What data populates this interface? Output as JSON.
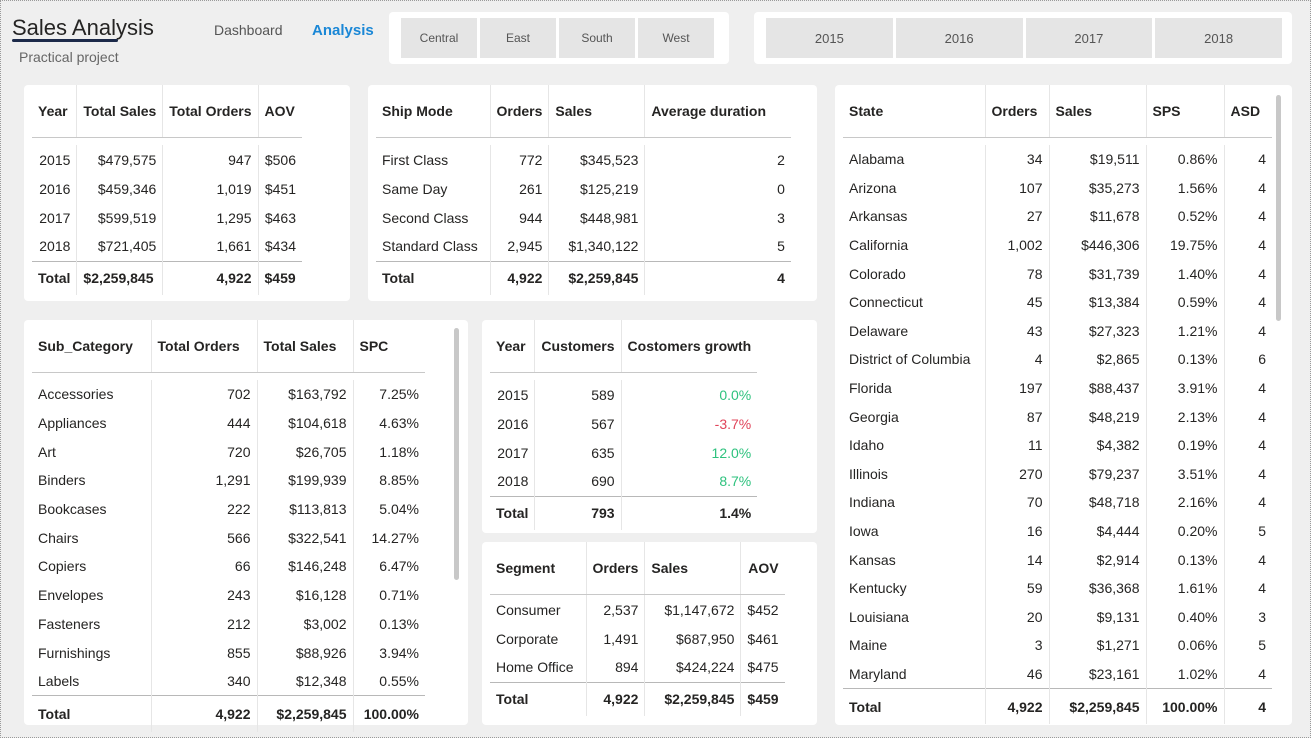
{
  "header": {
    "title": "Sales Analysis",
    "subtitle": "Practical project",
    "nav": [
      {
        "label": "Dashboard",
        "active": false
      },
      {
        "label": "Analysis",
        "active": true
      }
    ]
  },
  "region_slicer": [
    "Central",
    "East",
    "South",
    "West"
  ],
  "year_slicer": [
    "2015",
    "2016",
    "2017",
    "2018"
  ],
  "colors": {
    "accent": "#1a87d6",
    "positive": "#2ec27e",
    "negative": "#e0445a"
  },
  "year_table": {
    "headers": [
      "Year",
      "Total Sales",
      "Total Orders",
      "AOV"
    ],
    "rows": [
      [
        "2015",
        "$479,575",
        "947",
        "$506"
      ],
      [
        "2016",
        "$459,346",
        "1,019",
        "$451"
      ],
      [
        "2017",
        "$599,519",
        "1,295",
        "$463"
      ],
      [
        "2018",
        "$721,405",
        "1,661",
        "$434"
      ]
    ],
    "total": [
      "Total",
      "$2,259,845",
      "4,922",
      "$459"
    ]
  },
  "ship_table": {
    "headers": [
      "Ship Mode",
      "Orders",
      "Sales",
      "Average duration"
    ],
    "rows": [
      [
        "First Class",
        "772",
        "$345,523",
        "2"
      ],
      [
        "Same Day",
        "261",
        "$125,219",
        "0"
      ],
      [
        "Second Class",
        "944",
        "$448,981",
        "3"
      ],
      [
        "Standard Class",
        "2,945",
        "$1,340,122",
        "5"
      ]
    ],
    "total": [
      "Total",
      "4,922",
      "$2,259,845",
      "4"
    ]
  },
  "state_table": {
    "headers": [
      "State",
      "Orders",
      "Sales",
      "SPS",
      "ASD"
    ],
    "rows": [
      [
        "Alabama",
        "34",
        "$19,511",
        "0.86%",
        "4"
      ],
      [
        "Arizona",
        "107",
        "$35,273",
        "1.56%",
        "4"
      ],
      [
        "Arkansas",
        "27",
        "$11,678",
        "0.52%",
        "4"
      ],
      [
        "California",
        "1,002",
        "$446,306",
        "19.75%",
        "4"
      ],
      [
        "Colorado",
        "78",
        "$31,739",
        "1.40%",
        "4"
      ],
      [
        "Connecticut",
        "45",
        "$13,384",
        "0.59%",
        "4"
      ],
      [
        "Delaware",
        "43",
        "$27,323",
        "1.21%",
        "4"
      ],
      [
        "District of Columbia",
        "4",
        "$2,865",
        "0.13%",
        "6"
      ],
      [
        "Florida",
        "197",
        "$88,437",
        "3.91%",
        "4"
      ],
      [
        "Georgia",
        "87",
        "$48,219",
        "2.13%",
        "4"
      ],
      [
        "Idaho",
        "11",
        "$4,382",
        "0.19%",
        "4"
      ],
      [
        "Illinois",
        "270",
        "$79,237",
        "3.51%",
        "4"
      ],
      [
        "Indiana",
        "70",
        "$48,718",
        "2.16%",
        "4"
      ],
      [
        "Iowa",
        "16",
        "$4,444",
        "0.20%",
        "5"
      ],
      [
        "Kansas",
        "14",
        "$2,914",
        "0.13%",
        "4"
      ],
      [
        "Kentucky",
        "59",
        "$36,368",
        "1.61%",
        "4"
      ],
      [
        "Louisiana",
        "20",
        "$9,131",
        "0.40%",
        "3"
      ],
      [
        "Maine",
        "3",
        "$1,271",
        "0.06%",
        "5"
      ],
      [
        "Maryland",
        "46",
        "$23,161",
        "1.02%",
        "4"
      ]
    ],
    "total": [
      "Total",
      "4,922",
      "$2,259,845",
      "100.00%",
      "4"
    ]
  },
  "subcat_table": {
    "headers": [
      "Sub_Category",
      "Total Orders",
      "Total Sales",
      "SPC"
    ],
    "rows": [
      [
        "Accessories",
        "702",
        "$163,792",
        "7.25%"
      ],
      [
        "Appliances",
        "444",
        "$104,618",
        "4.63%"
      ],
      [
        "Art",
        "720",
        "$26,705",
        "1.18%"
      ],
      [
        "Binders",
        "1,291",
        "$199,939",
        "8.85%"
      ],
      [
        "Bookcases",
        "222",
        "$113,813",
        "5.04%"
      ],
      [
        "Chairs",
        "566",
        "$322,541",
        "14.27%"
      ],
      [
        "Copiers",
        "66",
        "$146,248",
        "6.47%"
      ],
      [
        "Envelopes",
        "243",
        "$16,128",
        "0.71%"
      ],
      [
        "Fasteners",
        "212",
        "$3,002",
        "0.13%"
      ],
      [
        "Furnishings",
        "855",
        "$88,926",
        "3.94%"
      ],
      [
        "Labels",
        "340",
        "$12,348",
        "0.55%"
      ]
    ],
    "total": [
      "Total",
      "4,922",
      "$2,259,845",
      "100.00%"
    ]
  },
  "customer_table": {
    "headers": [
      "Year",
      "Customers",
      "Costomers growth"
    ],
    "rows": [
      [
        "2015",
        "589",
        "0.0%"
      ],
      [
        "2016",
        "567",
        "-3.7%"
      ],
      [
        "2017",
        "635",
        "12.0%"
      ],
      [
        "2018",
        "690",
        "8.7%"
      ]
    ],
    "growth_color": [
      "positive",
      "negative",
      "positive",
      "positive"
    ],
    "total": [
      "Total",
      "793",
      "1.4%"
    ]
  },
  "segment_table": {
    "headers": [
      "Segment",
      "Orders",
      "Sales",
      "AOV"
    ],
    "rows": [
      [
        "Consumer",
        "2,537",
        "$1,147,672",
        "$452"
      ],
      [
        "Corporate",
        "1,491",
        "$687,950",
        "$461"
      ],
      [
        "Home Office",
        "894",
        "$424,224",
        "$475"
      ]
    ],
    "total": [
      "Total",
      "4,922",
      "$2,259,845",
      "$459"
    ]
  }
}
